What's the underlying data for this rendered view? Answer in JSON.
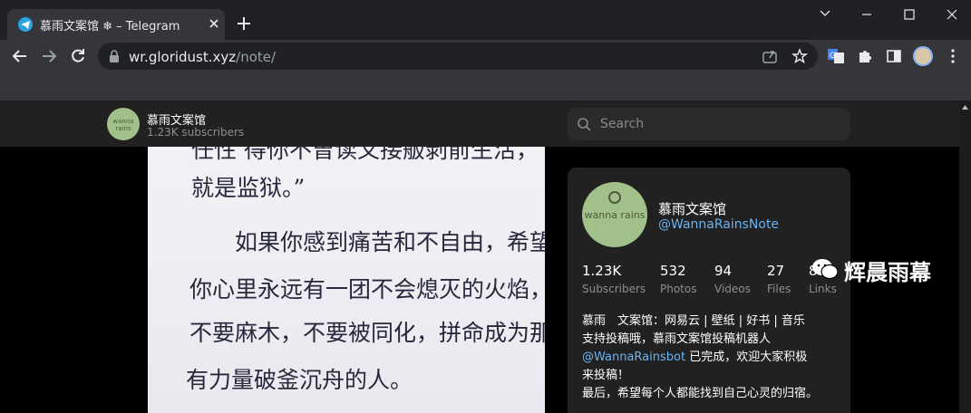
{
  "tab": {
    "title": "慕雨文案馆 ❄ – Telegram"
  },
  "omnibox": {
    "host": "wr.gloridust.xyz",
    "path": "/note/"
  },
  "channel": {
    "title": "慕雨文案馆",
    "subscribers": "1.23K subscribers",
    "avatar_text": "wanna rains",
    "handle": "@WannaRainsNote"
  },
  "search": {
    "placeholder": "Search"
  },
  "stats": [
    {
      "value": "1.23K",
      "label": "Subscribers"
    },
    {
      "value": "532",
      "label": "Photos"
    },
    {
      "value": "94",
      "label": "Videos"
    },
    {
      "value": "27",
      "label": "Files"
    },
    {
      "value": "88",
      "label": "Links"
    }
  ],
  "description": {
    "line1": "慕雨　文案馆：网易云 | 壁纸 | 好书 | 音乐",
    "line2": "支持投稿哦，慕雨文案馆投稿机器人",
    "bot_link": "@WannaRainsbot",
    "line3_rest": " 已完成，欢迎大家积极",
    "line4": "来投稿！",
    "line5": "最后，希望每个人都能找到自己心灵的归宿。"
  },
  "post_text": {
    "line0": "任性 得你不曾读又接舨剥前生活，",
    "line1": "就是监狱。”",
    "line2": "如果你感到痛苦和不自由，希望",
    "line3": "你心里永远有一团不会熄灭的火焰，",
    "line4": "不要麻木，不要被同化，拼命成为那个",
    "line5": "有力量破釜沉舟的人。"
  },
  "watermark": {
    "text": "辉晨雨幕"
  }
}
